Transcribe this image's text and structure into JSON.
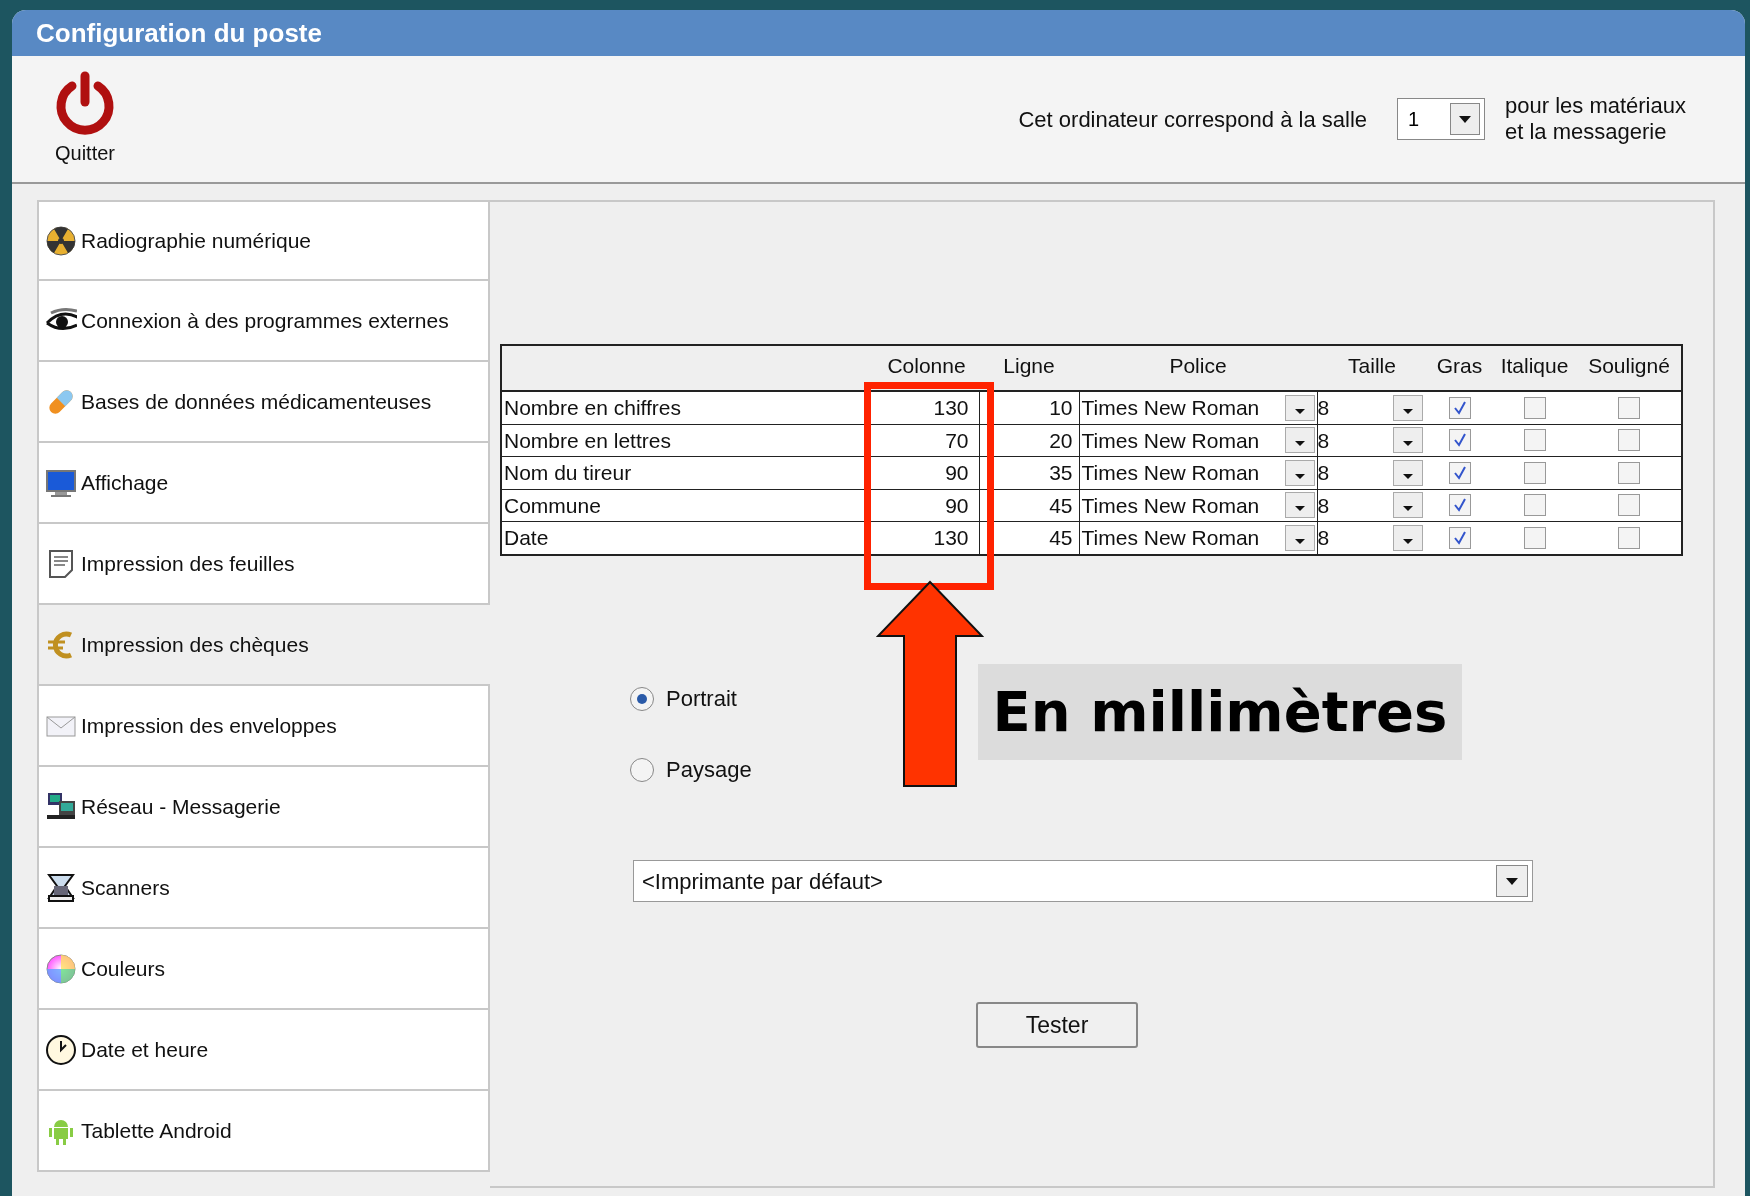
{
  "window": {
    "title": "Configuration du poste"
  },
  "toolbar": {
    "quit_label": "Quitter",
    "room_label": "Cet ordinateur correspond à la salle",
    "room_value": "1",
    "room_note": "pour les matériaux et la messagerie"
  },
  "sidebar": {
    "items": [
      {
        "label": "Radiographie numérique",
        "selected": false
      },
      {
        "label": "Connexion à des programmes externes",
        "selected": false
      },
      {
        "label": "Bases de données médicamenteuses",
        "selected": false
      },
      {
        "label": "Affichage",
        "selected": false
      },
      {
        "label": "Impression des feuilles",
        "selected": false
      },
      {
        "label": "Impression des chèques",
        "selected": true
      },
      {
        "label": "Impression des enveloppes",
        "selected": false
      },
      {
        "label": "Réseau - Messagerie",
        "selected": false
      },
      {
        "label": "Scanners",
        "selected": false
      },
      {
        "label": "Couleurs",
        "selected": false
      },
      {
        "label": "Date et heure",
        "selected": false
      },
      {
        "label": "Tablette Android",
        "selected": false
      }
    ]
  },
  "table": {
    "columns": [
      "Colonne",
      "Ligne",
      "Police",
      "Taille",
      "Gras",
      "Italique",
      "Souligné"
    ],
    "rows": [
      {
        "label": "Nombre en chiffres",
        "column": "130",
        "line": "10",
        "font": "Times New Roman",
        "size": "8",
        "bold": true,
        "italic": false,
        "underline": false
      },
      {
        "label": "Nombre en lettres",
        "column": "70",
        "line": "20",
        "font": "Times New Roman",
        "size": "8",
        "bold": true,
        "italic": false,
        "underline": false
      },
      {
        "label": "Nom du tireur",
        "column": "90",
        "line": "35",
        "font": "Times New Roman",
        "size": "8",
        "bold": true,
        "italic": false,
        "underline": false
      },
      {
        "label": "Commune",
        "column": "90",
        "line": "45",
        "font": "Times New Roman",
        "size": "8",
        "bold": true,
        "italic": false,
        "underline": false
      },
      {
        "label": "Date",
        "column": "130",
        "line": "45",
        "font": "Times New Roman",
        "size": "8",
        "bold": true,
        "italic": false,
        "underline": false
      }
    ]
  },
  "orientation": [
    {
      "label": "Portrait",
      "selected": true
    },
    {
      "label": "Paysage",
      "selected": false
    }
  ],
  "printer": {
    "value": "<Imprimante par défaut>"
  },
  "test_button": "Tester",
  "annotation": {
    "text": "En millimètres"
  }
}
